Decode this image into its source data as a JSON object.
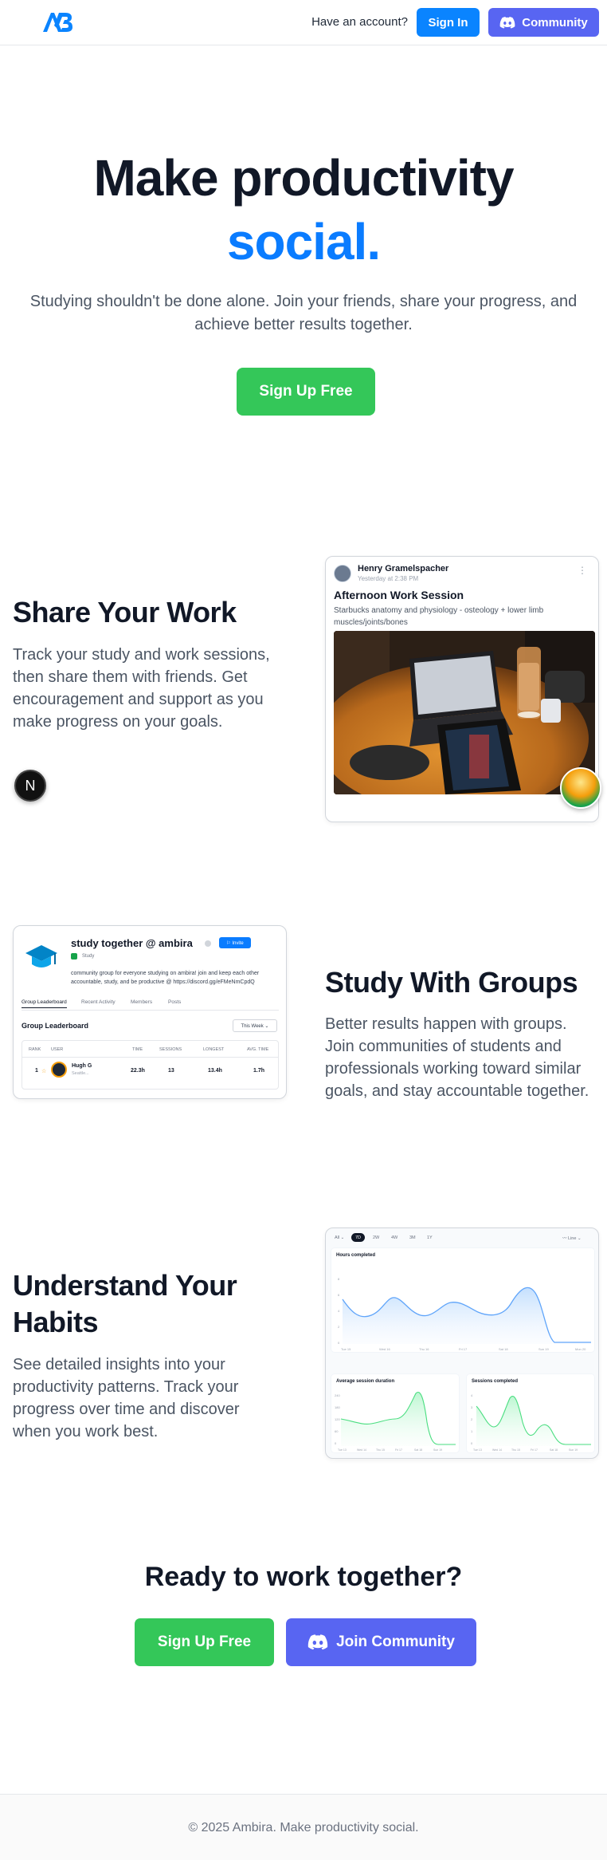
{
  "header": {
    "have_account": "Have an account?",
    "signin_label": "Sign In",
    "community_label": "Community"
  },
  "hero": {
    "line1": "Make productivity",
    "line2": "social.",
    "subtitle": "Studying shouldn't be done alone. Join your friends, share your progress, and achieve better results together.",
    "cta_label": "Sign Up Free"
  },
  "features": [
    {
      "title": "Share Your Work",
      "description": "Track your study and work sessions, then share them with friends. Get encouragement and support as you make progress on your goals."
    },
    {
      "title": "Study With Groups",
      "description": "Better results happen with groups. Join communities of students and professionals working toward similar goals, and stay accountable together."
    },
    {
      "title": "Understand Your Habits",
      "description": "See detailed insights into your productivity patterns. Track your progress over time and discover when you work best."
    }
  ],
  "nav_badge": "N",
  "post": {
    "user": "Henry Gramelspacher",
    "time": "Yesterday at 2:38 PM",
    "menu": "⋮",
    "title": "Afternoon Work Session",
    "description": "Starbucks anatomy and physiology - osteology + lower limb muscles/joints/bones"
  },
  "group": {
    "name": "study together @ ambira",
    "invite": "⚐ Invite",
    "category": "Study",
    "description": "community group for everyone studying on ambira! join and keep each other accountable, study, and be productive @ https://discord.gg/eFMeNmCpdQ",
    "tabs": [
      "Group Leaderboard",
      "Recent Activity",
      "Members",
      "Posts"
    ],
    "section_title": "Group Leaderboard",
    "period": "This Week  ⌄",
    "columns": [
      "RANK",
      "USER",
      "TIME",
      "SESSIONS",
      "LONGEST",
      "AVG. TIME"
    ],
    "row": {
      "rank": "1",
      "medal": "☆",
      "name": "Hugh G",
      "location": "Seattle...",
      "time": "22.3h",
      "sessions": "13",
      "longest": "13.4h",
      "avg": "1.7h"
    }
  },
  "analytics": {
    "ranges": [
      "All ⌄",
      "7D",
      "2W",
      "4W",
      "3M",
      "1Y"
    ],
    "active_range": 1,
    "chart_type_label": "〰 Line ⌄",
    "main_title": "Hours completed",
    "main_y_ticks": [
      "8",
      "6",
      "4",
      "2",
      "0"
    ],
    "main_x_ticks": [
      "Tue 15",
      "Wed 16",
      "Thu 16",
      "Fri 17",
      "Sat 18",
      "Sun 19",
      "Mon 20"
    ],
    "left_title": "Average session duration",
    "left_y_ticks": [
      "240",
      "180",
      "120",
      "60",
      "0"
    ],
    "right_title": "Sessions completed",
    "right_y_ticks": [
      "4",
      "3",
      "2",
      "1",
      "0"
    ],
    "small_x_ticks": [
      "Tue 13",
      "Wed 14",
      "Thu 15",
      "Fri 17",
      "Sat 18",
      "Sun 19"
    ],
    "accent_color": "#7ab8f5",
    "green_color": "#4ade80"
  },
  "cta": {
    "title": "Ready to work together?",
    "signup_label": "Sign Up Free",
    "community_label": "Join Community"
  },
  "footer": {
    "text": "© 2025 Ambira. Make productivity social."
  },
  "colors": {
    "blue": "#0a84ff",
    "green": "#34c759",
    "discord": "#5865f2"
  }
}
